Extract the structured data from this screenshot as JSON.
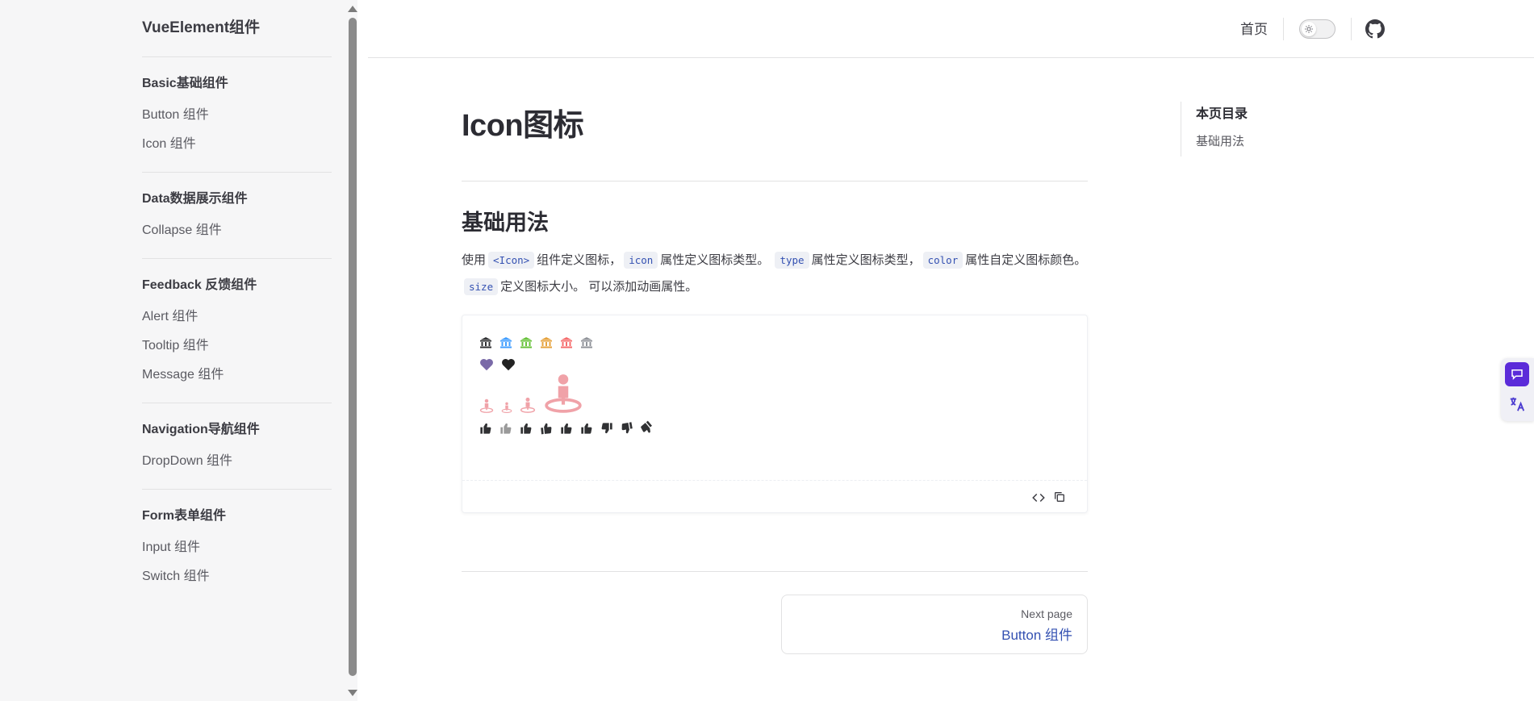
{
  "sidebar": {
    "brand": "VueElement组件",
    "groups": [
      {
        "title": "Basic基础组件",
        "items": [
          "Button 组件",
          "Icon 组件"
        ]
      },
      {
        "title": "Data数据展示组件",
        "items": [
          "Collapse 组件"
        ]
      },
      {
        "title": "Feedback 反馈组件",
        "items": [
          "Alert 组件",
          "Tooltip 组件",
          "Message 组件"
        ]
      },
      {
        "title": "Navigation导航组件",
        "items": [
          "DropDown 组件"
        ]
      },
      {
        "title": "Form表单组件",
        "items": [
          "Input 组件",
          "Switch 组件"
        ]
      }
    ]
  },
  "header": {
    "home_label": "首页",
    "theme_toggle": "light",
    "github_icon": "github-icon"
  },
  "main": {
    "title": "Icon图标",
    "section_title": "基础用法",
    "description": {
      "t1": "使用",
      "c1": "<Icon>",
      "t2": "组件定义图标，",
      "c2": "icon",
      "t3": "属性定义图标类型。",
      "c3": "type",
      "t4": "属性定义图标类型，",
      "c4": "color",
      "t5": "属性自定义图标颜色。",
      "c5": "size",
      "t6": "定义图标大小。 可以添加动画属性。"
    },
    "demo": {
      "row1_colors": [
        "#303133",
        "#409eff",
        "#67c23a",
        "#e6a23c",
        "#f56c6c",
        "#909399"
      ],
      "row2_colors": [
        "#7a6aa8",
        "#222222"
      ],
      "row3_color": "#f0a2a8",
      "row4_color": "#303133",
      "code_toggle_icon": "code-icon",
      "copy_icon": "copy-icon"
    },
    "next": {
      "label": "Next page",
      "title": "Button 组件"
    }
  },
  "outline": {
    "title": "本页目录",
    "links": [
      "基础用法"
    ]
  },
  "accent_color": "#3451b2"
}
